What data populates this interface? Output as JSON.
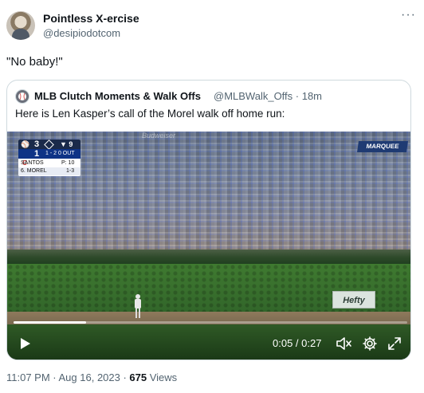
{
  "tweet": {
    "author_name": "Pointless X-ercise",
    "author_handle": "@desipiodotcom",
    "more_icon": "more-horizontal-icon",
    "text": "\"No baby!\""
  },
  "quoted": {
    "author_name": "MLB Clutch Moments & Walk Offs",
    "author_handle_time": "@MLBWalk_Offs · 18m",
    "text": "Here is Len Kasper’s call of the Morel walk off home run:"
  },
  "video": {
    "signage": {
      "top_sign": "Budweiser",
      "marquee": "MARQUEE",
      "wall_ad": "Hefty"
    },
    "scoreboard": {
      "away_score": "3",
      "home_score": "1",
      "home_logo": "C",
      "inning": "▼ 9",
      "count": "1 - 2  0 OUT",
      "pitcher_label": "SANTOS",
      "pitch_count": "P: 10",
      "batter_label": "6. MOREL",
      "batter_line": "1-3"
    },
    "progress_fraction": 0.185,
    "time_display": "0:05 / 0:27",
    "icons": [
      "play-icon",
      "mute-icon",
      "gear-icon",
      "expand-icon"
    ]
  },
  "meta": {
    "timestamp": "11:07 PM · Aug 16, 2023 · ",
    "views_count": "675",
    "views_label": " Views"
  },
  "colors": {
    "text_primary": "#0f1419",
    "text_secondary": "#536471",
    "border": "#cfd9de",
    "cubs_blue": "#0e3386"
  }
}
